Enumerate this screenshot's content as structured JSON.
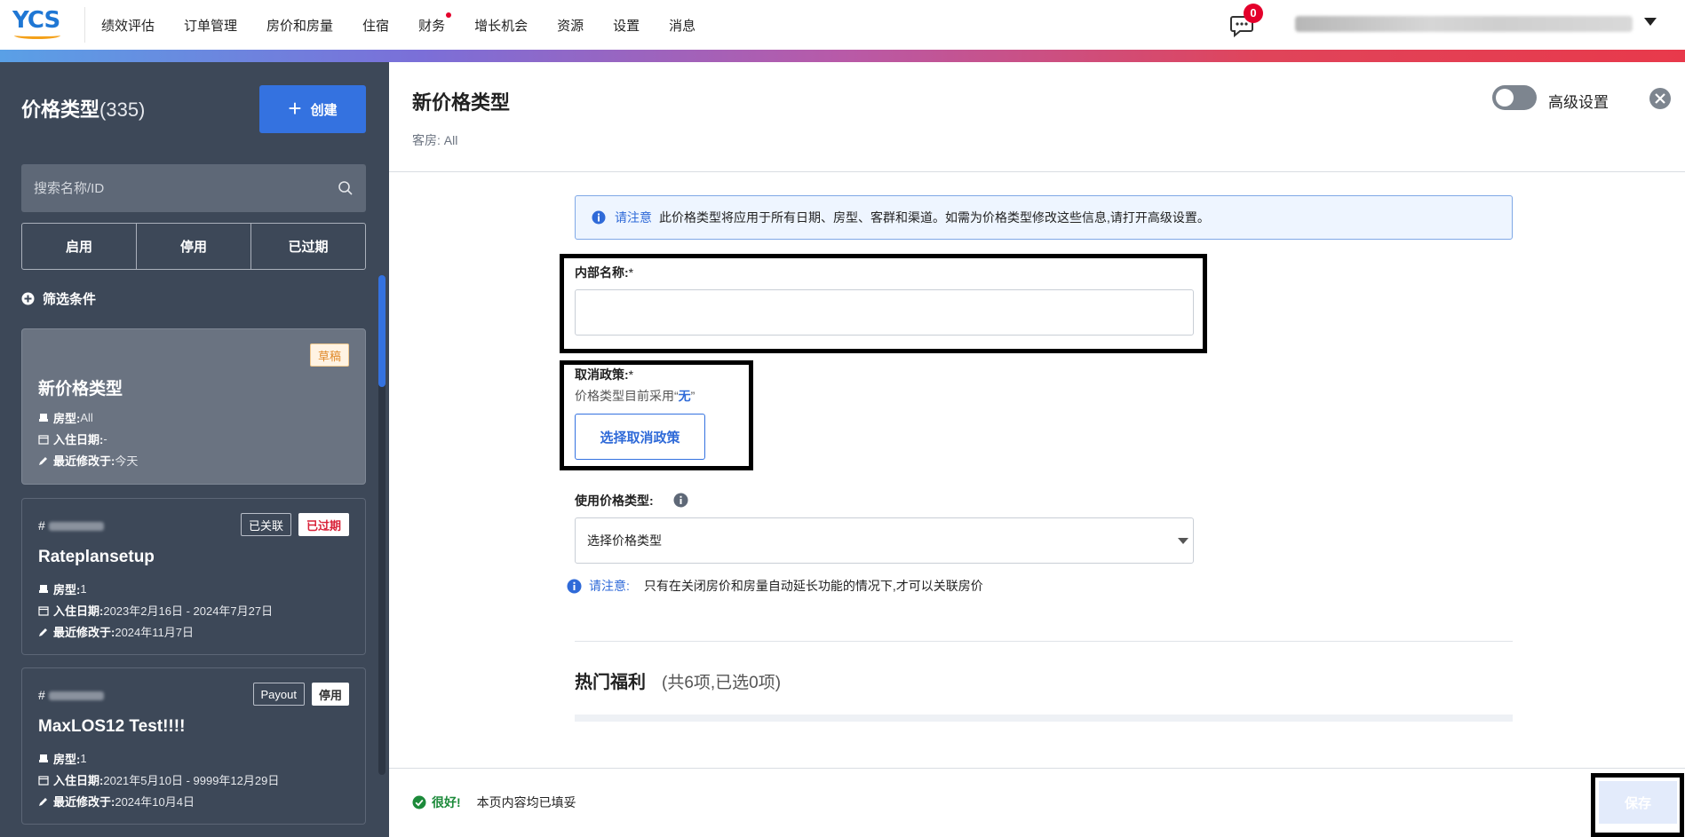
{
  "topnav": {
    "logo": "YCS",
    "items": [
      "绩效评估",
      "订单管理",
      "房价和房量",
      "住宿",
      "财务",
      "增长机会",
      "资源",
      "设置",
      "消息"
    ],
    "message_count": "0"
  },
  "sidebar": {
    "title": "价格类型",
    "count": "(335)",
    "create_label": "创建",
    "search_placeholder": "搜索名称/ID",
    "status_tabs": [
      "启用",
      "停用",
      "已过期"
    ],
    "filter_label": "筛选条件",
    "cards": [
      {
        "id_prefix": "",
        "badges": [
          "草稿"
        ],
        "title": "新价格类型",
        "room_label": "房型:",
        "room_value": "All",
        "checkin_label": "入住日期:",
        "checkin_value": "-",
        "modified_label": "最近修改于:",
        "modified_value": "今天"
      },
      {
        "id_prefix": "#",
        "badges": [
          "已关联",
          "已过期"
        ],
        "title": "Rateplansetup",
        "room_label": "房型:",
        "room_value": "1",
        "checkin_label": "入住日期:",
        "checkin_value": "2023年2月16日 - 2024年7月27日",
        "modified_label": "最近修改于:",
        "modified_value": "2024年11月7日"
      },
      {
        "id_prefix": "#",
        "badges": [
          "Payout",
          "停用"
        ],
        "title": "MaxLOS12 Test!!!!",
        "room_label": "房型:",
        "room_value": "1",
        "checkin_label": "入住日期:",
        "checkin_value": "2021年5月10日 - 9999年12月29日",
        "modified_label": "最近修改于:",
        "modified_value": "2024年10月4日"
      }
    ]
  },
  "main": {
    "title": "新价格类型",
    "subtitle": "客房: All",
    "advanced_label": "高级设置",
    "notice": {
      "strong": "请注意",
      "text": "此价格类型将应用于所有日期、房型、客群和渠道。如需为价格类型修改这些信息,请打开高级设置。"
    },
    "internal_name_label": "内部名称:",
    "required_mark": "*",
    "internal_name_value": "",
    "cancel_policy_label": "取消政策:",
    "cancel_hint_prefix": "价格类型目前采用“",
    "cancel_hint_value": "无",
    "cancel_hint_suffix": "”",
    "cancel_btn": "选择取消政策",
    "use_rate_label": "使用价格类型:",
    "select_value": "选择价格类型",
    "note2_strong": "请注意:",
    "note2_text": "只有在关闭房价和房量自动延长功能的情况下,才可以关联房价",
    "benefits_title": "热门福利",
    "benefits_count": "(共6项,已选0项)",
    "footer_good": "很好!",
    "footer_text": "本页内容均已填妥",
    "save_label": "保存"
  }
}
